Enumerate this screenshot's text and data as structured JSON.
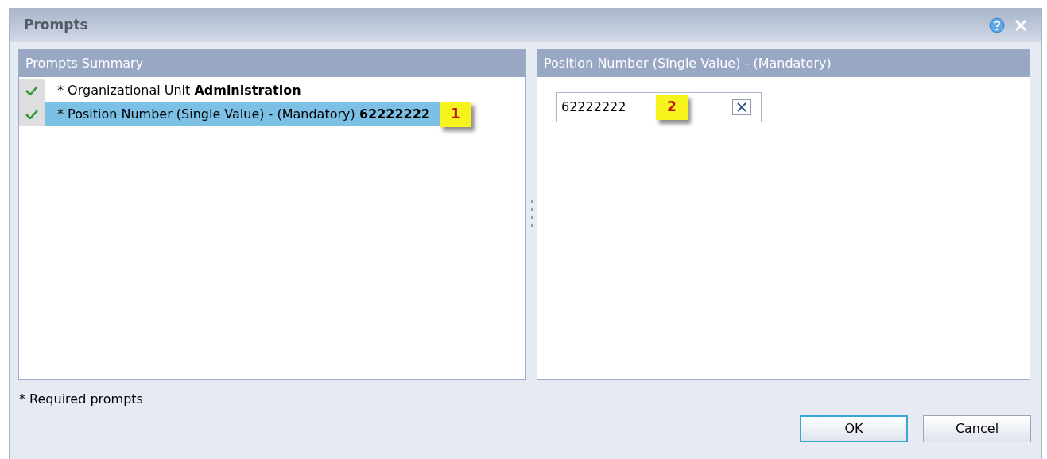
{
  "window": {
    "title": "Prompts"
  },
  "summary": {
    "title": "Prompts Summary",
    "items": [
      {
        "label": "* Organizational Unit",
        "value": "Administration",
        "done": true,
        "selected": false
      },
      {
        "label": "* Position Number (Single Value) - (Mandatory)",
        "value": "62222222",
        "done": true,
        "selected": true,
        "callout": "1"
      }
    ]
  },
  "detail": {
    "title": "Position Number (Single Value) - (Mandatory)",
    "value": "62222222",
    "callout": "2"
  },
  "footnote": "* Required prompts",
  "buttons": [
    {
      "label": "OK",
      "default": true
    },
    {
      "label": "Cancel",
      "default": false
    }
  ]
}
